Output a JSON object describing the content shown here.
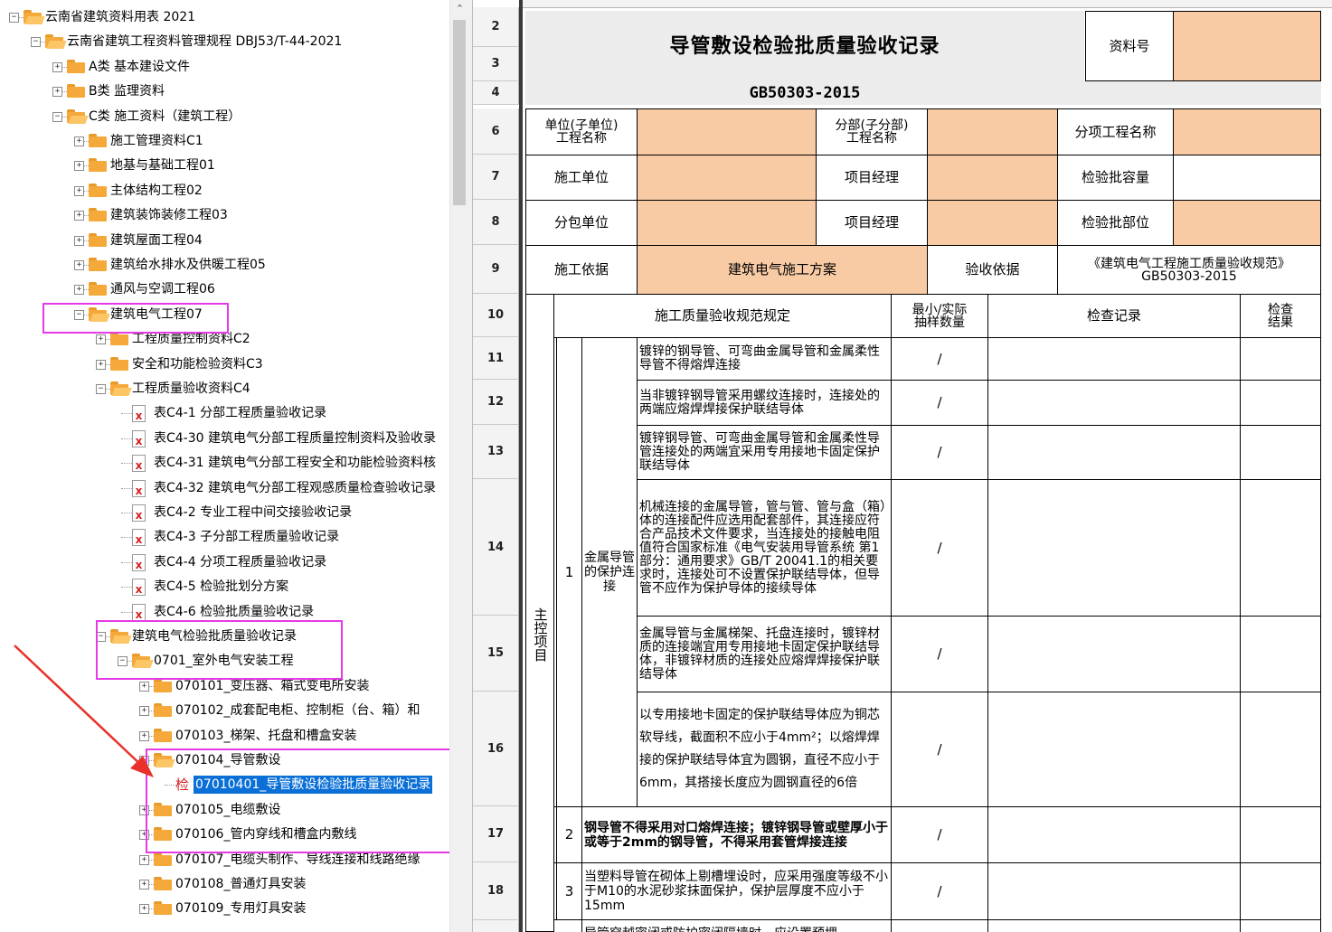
{
  "tree": {
    "nodes": [
      {
        "label": "云南省建筑资料用表 2021",
        "level": 0,
        "icon": "folder-open",
        "state": "minus"
      },
      {
        "label": "云南省建筑工程资料管理规程 DBJ53/T-44-2021",
        "level": 1,
        "icon": "folder-open",
        "state": "minus"
      },
      {
        "label": "A类 基本建设文件",
        "level": 2,
        "icon": "folder",
        "state": "plus"
      },
      {
        "label": "B类 监理资料",
        "level": 2,
        "icon": "folder",
        "state": "plus"
      },
      {
        "label": "C类 施工资料（建筑工程）",
        "level": 2,
        "icon": "folder-open",
        "state": "minus"
      },
      {
        "label": "施工管理资料C1",
        "level": 3,
        "icon": "folder",
        "state": "plus"
      },
      {
        "label": "地基与基础工程01",
        "level": 3,
        "icon": "folder",
        "state": "plus"
      },
      {
        "label": "主体结构工程02",
        "level": 3,
        "icon": "folder",
        "state": "plus"
      },
      {
        "label": "建筑装饰装修工程03",
        "level": 3,
        "icon": "folder",
        "state": "plus"
      },
      {
        "label": "建筑屋面工程04",
        "level": 3,
        "icon": "folder",
        "state": "plus"
      },
      {
        "label": "建筑给水排水及供暖工程05",
        "level": 3,
        "icon": "folder",
        "state": "plus"
      },
      {
        "label": "通风与空调工程06",
        "level": 3,
        "icon": "folder",
        "state": "plus"
      },
      {
        "label": "建筑电气工程07",
        "level": 3,
        "icon": "folder-open",
        "state": "minus"
      },
      {
        "label": "工程质量控制资料C2",
        "level": 4,
        "icon": "folder",
        "state": "plus"
      },
      {
        "label": "安全和功能检验资料C3",
        "level": 4,
        "icon": "folder",
        "state": "plus"
      },
      {
        "label": "工程质量验收资料C4",
        "level": 4,
        "icon": "folder-open",
        "state": "minus"
      },
      {
        "label": "表C4-1  分部工程质量验收记录",
        "level": 5,
        "icon": "doc",
        "state": "none"
      },
      {
        "label": "表C4-30  建筑电气分部工程质量控制资料及验收录",
        "level": 5,
        "icon": "doc",
        "state": "none"
      },
      {
        "label": "表C4-31  建筑电气分部工程安全和功能检验资料核",
        "level": 5,
        "icon": "doc",
        "state": "none"
      },
      {
        "label": "表C4-32  建筑电气分部工程观感质量检查验收记录",
        "level": 5,
        "icon": "doc",
        "state": "none"
      },
      {
        "label": "表C4-2  专业工程中间交接验收记录",
        "level": 5,
        "icon": "doc",
        "state": "none"
      },
      {
        "label": "表C4-3  子分部工程质量验收记录",
        "level": 5,
        "icon": "doc",
        "state": "none"
      },
      {
        "label": "表C4-4  分项工程质量验收记录",
        "level": 5,
        "icon": "doc",
        "state": "none"
      },
      {
        "label": "表C4-5  检验批划分方案",
        "level": 5,
        "icon": "doc",
        "state": "none"
      },
      {
        "label": "表C4-6  检验批质量验收记录",
        "level": 5,
        "icon": "doc",
        "state": "none"
      },
      {
        "label": "建筑电气检验批质量验收记录",
        "level": 4,
        "icon": "folder-open",
        "state": "minus"
      },
      {
        "label": "0701_室外电气安装工程",
        "level": 5,
        "icon": "folder-open",
        "state": "minus"
      },
      {
        "label": "070101_变压器、箱式变电所安装",
        "level": 6,
        "icon": "folder",
        "state": "plus"
      },
      {
        "label": "070102_成套配电柜、控制柜（台、箱）和",
        "level": 6,
        "icon": "folder",
        "state": "plus"
      },
      {
        "label": "070103_梯架、托盘和槽盒安装",
        "level": 6,
        "icon": "folder",
        "state": "plus"
      },
      {
        "label": "070104_导管敷设",
        "level": 6,
        "icon": "folder-open",
        "state": "minus"
      },
      {
        "label": "07010401_导管敷设检验批质量验收记录",
        "level": 7,
        "icon": "jian",
        "state": "none",
        "selected": true
      },
      {
        "label": "070105_电缆敷设",
        "level": 6,
        "icon": "folder",
        "state": "plus"
      },
      {
        "label": "070106_管内穿线和槽盒内敷线",
        "level": 6,
        "icon": "folder",
        "state": "plus"
      },
      {
        "label": "070107_电缆头制作、导线连接和线路绝缘",
        "level": 6,
        "icon": "folder",
        "state": "plus"
      },
      {
        "label": "070108_普通灯具安装",
        "level": 6,
        "icon": "folder",
        "state": "plus"
      },
      {
        "label": "070109_专用灯具安装",
        "level": 6,
        "icon": "folder",
        "state": "plus"
      }
    ],
    "jian_glyph": "检"
  },
  "sheet": {
    "row_numbers": [
      "2",
      "3",
      "4",
      "6",
      "7",
      "8",
      "9",
      "10",
      "11",
      "12",
      "13",
      "14",
      "15",
      "16",
      "17",
      "18"
    ],
    "title": "导管敷设检验批质量验收记录",
    "standard": "GB50303-2015",
    "doc_no_label": "资料号",
    "unit_project_label": "单位(子单位)\n工程名称",
    "sub_project_label": "分部(子分部)\n工程名称",
    "item_project_label": "分项工程名称",
    "contractor_label": "施工单位",
    "pm_label": "项目经理",
    "batch_capacity_label": "检验批容量",
    "subcontractor_label": "分包单位",
    "pm_label2": "项目经理",
    "batch_part_label": "检验批部位",
    "basis_label": "施工依据",
    "basis_value": "建筑电气施工方案",
    "accept_basis_label": "验收依据",
    "accept_basis_value": "《建筑电气工程施工质量验收规范》\nGB50303-2015",
    "spec_header": "施工质量验收规范规定",
    "sample_header": "最小/实际\n抽样数量",
    "check_record_header": "检查记录",
    "check_result_header": "检查\n结果",
    "main_control": "主控项目",
    "item1_no": "1",
    "item1_title": "金属导管的保护连接",
    "item1_rows": [
      "镀锌的钢导管、可弯曲金属导管和金属柔性导管不得熔焊连接",
      "当非镀锌钢导管采用螺纹连接时，连接处的两端应熔焊焊接保护联结导体",
      "镀锌钢导管、可弯曲金属导管和金属柔性导管连接处的两端宜采用专用接地卡固定保护联结导体",
      "机械连接的金属导管，管与管、管与盒（箱）体的连接配件应选用配套部件，其连接应符合产品技术文件要求，当连接处的接触电阻值符合国家标准《电气安装用导管系统 第1部分：通用要求》GB/T 20041.1的相关要求时，连接处可不设置保护联结导体，但导管不应作为保护导体的接续导体",
      "金属导管与金属梯架、托盘连接时，镀锌材质的连接端宜用专用接地卡固定保护联结导体，非镀锌材质的连接处应熔焊焊接保护联结导体",
      "以专用接地卡固定的保护联结导体应为铜芯软导线，截面积不应小于4mm²；以熔焊焊接的保护联结导体宜为圆钢，直径不应小于6mm，其搭接长度应为圆钢直径的6倍"
    ],
    "item2_no": "2",
    "item2_text": "钢导管不得采用对口熔焊连接；镀锌钢导管或壁厚小于或等于2mm的钢导管，不得采用套管焊接连接",
    "item3_no": "3",
    "item3_text": "当塑料导管在砌体上剔槽埋设时，应采用强度等级不小于M10的水泥砂浆抹面保护，保护层厚度不应小于15mm",
    "slash": "/",
    "row19_fragment": "导管穿越密闭或防护密闭隔墙时，应设置预埋"
  },
  "colors": {
    "peach": "#f9cba5",
    "highlight": "#e53be6",
    "selection": "#0a6fd6",
    "arrow": "#e8312a"
  }
}
